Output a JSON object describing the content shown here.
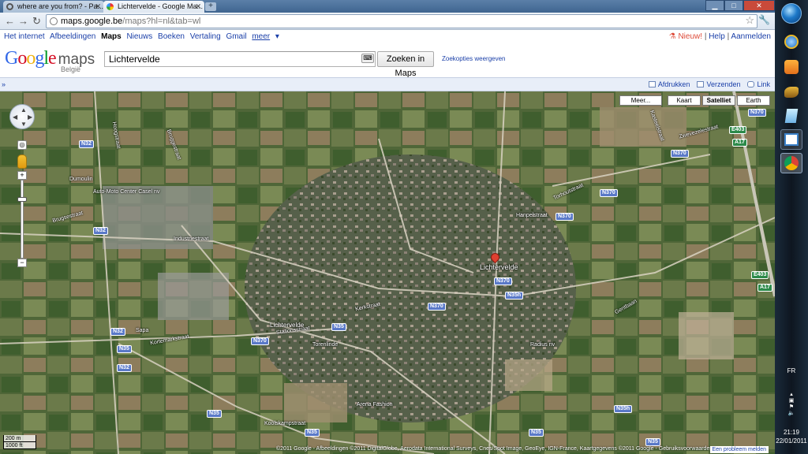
{
  "browser": {
    "tabs": [
      {
        "label": "where are you from? - Pa..."
      },
      {
        "label": "Lichtervelde - Google Ma..."
      }
    ],
    "new_tab": "+",
    "url_domain": "maps.google.be",
    "url_path": "/maps?hl=nl&tab=wl"
  },
  "gbar": {
    "items": [
      "Het internet",
      "Afbeeldingen",
      "Maps",
      "Nieuws",
      "Boeken",
      "Vertaling",
      "Gmail",
      "meer"
    ],
    "new_label": "Nieuw!",
    "help": "Help",
    "signin": "Aanmelden",
    "sep": "|"
  },
  "header": {
    "logo_google": "Google",
    "logo_maps": "maps",
    "region": "België",
    "search_value": "Lichtervelde",
    "search_button": "Zoeken in Maps",
    "options": "Zoekopties weergeven"
  },
  "linkbar": {
    "collapse": "»",
    "print": "Afdrukken",
    "send": "Verzenden",
    "link": "Link"
  },
  "map": {
    "type_buttons": [
      "Meer...",
      "Kaart",
      "Satelliet",
      "Earth"
    ],
    "selected_type": "Satelliet",
    "place_label": "Lichtervelde",
    "station_label": "Lichtervelde",
    "streets": [
      "Dumoulin",
      "Hoogstraat",
      "Kortemarkstraat",
      "Brugsestraat",
      "Industriestraat",
      "Sapa",
      "Koolskampstraat",
      "Zwevezelestraat",
      "Hanpelstraat",
      "Kasteelstraat",
      "Torhoutstraat",
      "Kerkstraat",
      "Stationsstraat",
      "Torenlinde",
      "Arena Fashion",
      "Auto-Moto Center Casel nv",
      "Radius nv",
      "Gentbaan",
      "Bruggestraat"
    ],
    "route_shields": [
      "N32",
      "N32",
      "N32",
      "N32",
      "N370",
      "N370",
      "N370",
      "N370",
      "N370",
      "N370",
      "N370",
      "N35",
      "N35",
      "N35",
      "N35",
      "N35",
      "N35",
      "N35h",
      "N35h"
    ],
    "highway_shields": [
      "E403",
      "E403",
      "A17",
      "A17"
    ],
    "scale_top": "200 m",
    "scale_bottom": "1000 ft",
    "copyright": "©2011 Google - Afbeeldingen ©2011 DigitalGlobe, Aerodata International Surveys, Cnes/Spot Image, GeoEye, IGN-France, Kaartgegevens ©2011 Google - Gebruiksvoorwaarden",
    "report": "Een probleem melden"
  },
  "taskbar": {
    "language": "FR",
    "time": "21:19",
    "date": "22/01/2011"
  }
}
